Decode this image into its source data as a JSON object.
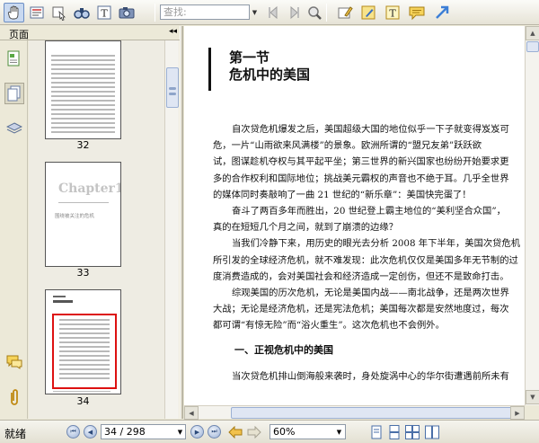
{
  "toolbar": {
    "search_placeholder": "查找:",
    "icons": [
      "hand-tool-icon",
      "select-text-icon",
      "snapshot-icon",
      "find-icon",
      "text-tool-icon",
      "camera-icon",
      "prev-result-icon",
      "next-result-icon",
      "search-options-icon",
      "highlight-icon",
      "note-edit-icon",
      "text-box-icon",
      "comment-icon",
      "arrow-icon"
    ]
  },
  "panel": {
    "title": "页面",
    "collapse": "◂◂",
    "icons": [
      "pages-icon",
      "thumbnails-icon",
      "layers-icon",
      "comments-icon",
      "attachment-icon"
    ]
  },
  "thumbnails": {
    "pages": [
      {
        "label": "32"
      },
      {
        "label": "33",
        "chapter": "Chapter1",
        "caption": "围绕被关注的危机"
      },
      {
        "label": "34",
        "selected": true
      }
    ]
  },
  "document": {
    "heading_line1": "第一节",
    "heading_line2": "危机中的美国",
    "paragraphs": [
      {
        "lines": [
          "自次贷危机爆发之后，美国超级大国的地位似乎一下子就变得岌岌可",
          "危，一片“山雨欲来风满楼”的景象。欧洲所谓的“盟兄友弟”跃跃欲",
          "试，图谋趁机夺权与其平起平坐；第三世界的新兴国家也纷纷开始要求更",
          "多的合作权利和国际地位；挑战美元霸权的声音也不绝于耳。几乎全世界",
          "的媒体同时奏敲响了一曲 21 世纪的“新乐章”：美国快完蛋了！"
        ]
      },
      {
        "lines": [
          "奋斗了两百多年而胜出，20 世纪登上霸主地位的“美利坚合众国”，",
          "真的在短短几个月之间，就到了崩溃的边缘？"
        ]
      },
      {
        "lines": [
          "当我们冷静下来，用历史的眼光去分析 2008 年下半年，美国次贷危机",
          "所引发的全球经济危机，就不难发现：此次危机仅仅是美国多年无节制的过",
          "度消费造成的，会对美国社会和经济造成一定创伤，但还不是致命打击。"
        ]
      },
      {
        "lines": [
          "综观美国的历次危机，无论是美国内战——南北战争，还是两次世界",
          "大战；无论是经济危机，还是宪法危机；美国每次都是安然地度过，每次",
          "都可谓“有惊无险”而“浴火重生”。这次危机也不会例外。"
        ]
      }
    ],
    "subheading": "一、正视危机中的美国",
    "last_line": "当次贷危机排山倒海般来袭时，身处旋涡中心的华尔街遭遇前所未有"
  },
  "status": {
    "text": "就绪",
    "page_display": "34 / 298",
    "zoom": "60%",
    "nav_icons": [
      "first-page-icon",
      "prev-page-icon",
      "next-page-icon",
      "last-page-icon"
    ],
    "history_icons": [
      "go-back-icon",
      "go-forward-icon"
    ],
    "layout_icons": [
      "single-page-icon",
      "continuous-icon",
      "facing-icon",
      "continuous-facing-icon"
    ]
  }
}
